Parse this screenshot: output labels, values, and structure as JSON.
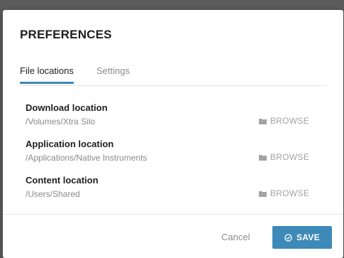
{
  "dialog": {
    "title": "PREFERENCES"
  },
  "tabs": [
    {
      "label": "File locations",
      "active": true
    },
    {
      "label": "Settings",
      "active": false
    }
  ],
  "locations": [
    {
      "label": "Download location",
      "path": "/Volumes/Xtra Silo",
      "action": "BROWSE",
      "icon": "folder-icon"
    },
    {
      "label": "Application location",
      "path": "/Applications/Native Instruments",
      "action": "BROWSE",
      "icon": "folder-icon"
    },
    {
      "label": "Content location",
      "path": "/Users/Shared",
      "action": "BROWSE",
      "icon": "folder-icon"
    }
  ],
  "footer": {
    "cancel_label": "Cancel",
    "save_label": "SAVE",
    "save_icon": "check-circle-icon"
  },
  "colors": {
    "accent": "#3d89b8",
    "muted_text": "#8a8a8a",
    "browse_text": "#a3a3a3"
  }
}
